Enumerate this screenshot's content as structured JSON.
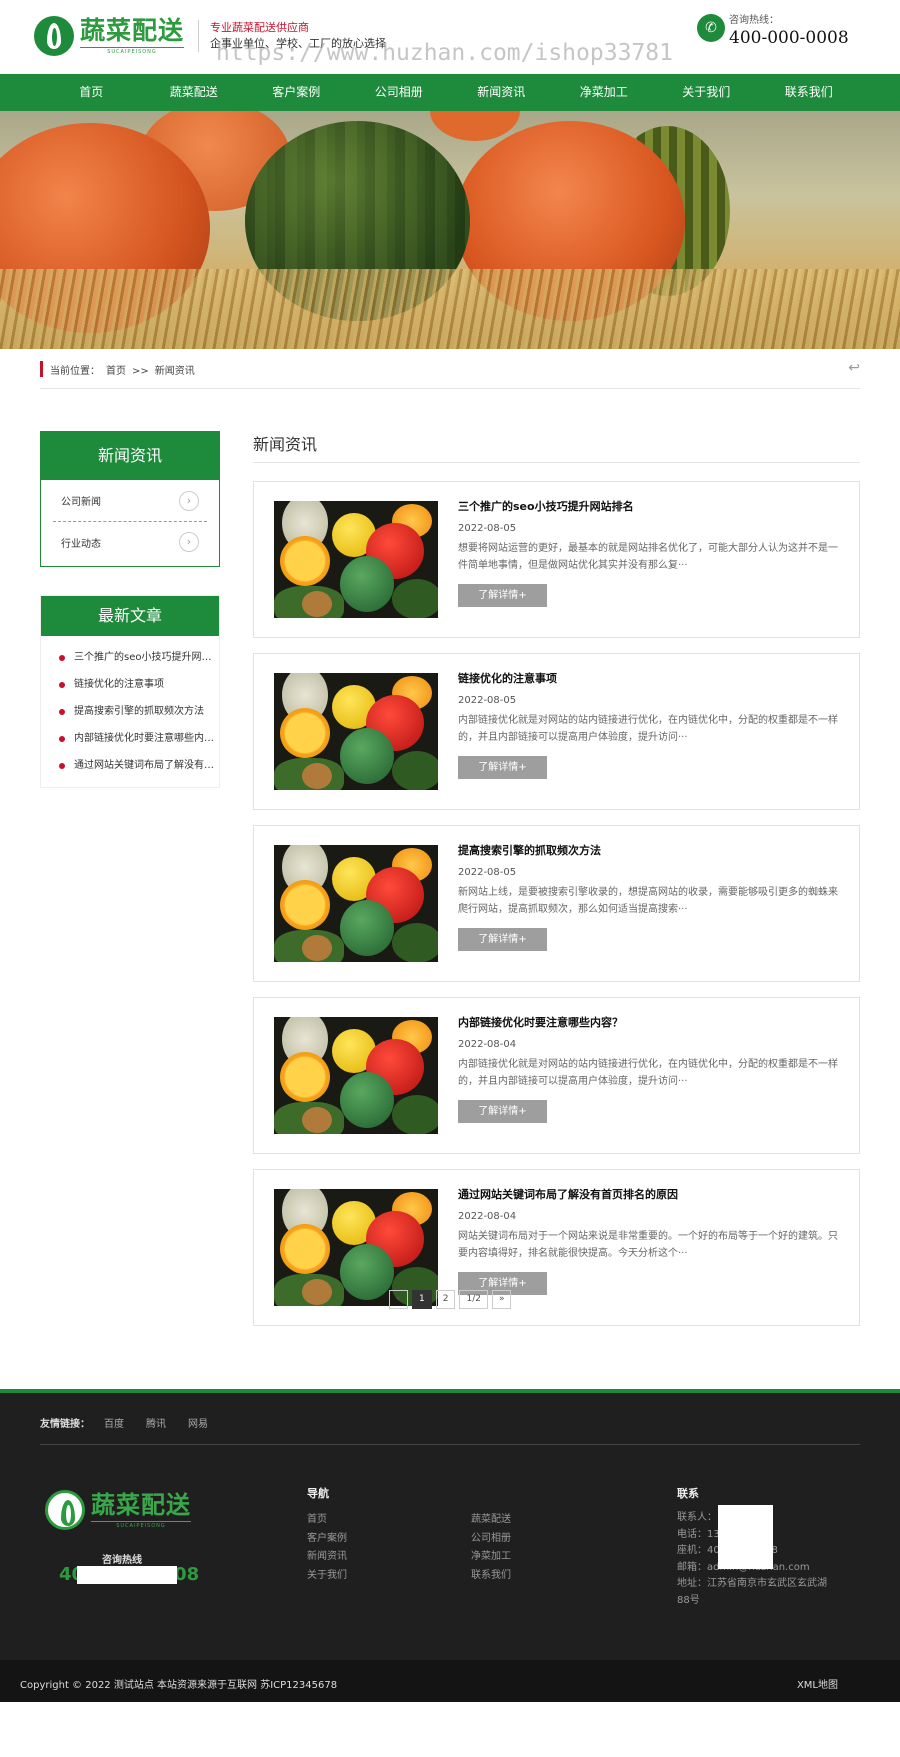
{
  "header": {
    "logo_cn": "蔬菜配送",
    "logo_en": "SUCAIPEISONG",
    "slogan_1": "专业蔬菜配送供应商",
    "slogan_2": "企事业单位、学校、工厂的放心选择",
    "watermark": "https://www.huzhan.com/ishop33781",
    "hotline_label": "咨询热线：",
    "hotline_number": "400-000-0008"
  },
  "nav": [
    "首页",
    "蔬菜配送",
    "客户案例",
    "公司相册",
    "新闻资讯",
    "净菜加工",
    "关于我们",
    "联系我们"
  ],
  "breadcrumb": {
    "label": "当前位置：",
    "home": "首页",
    "sep": ">>",
    "current": "新闻资讯"
  },
  "sidebar": {
    "category_title": "新闻资讯",
    "categories": [
      "公司新闻",
      "行业动态"
    ],
    "latest_title": "最新文章",
    "latest": [
      "三个推广的seo小技巧提升网站排名",
      "链接优化的注意事项",
      "提高搜索引擎的抓取频次方法",
      "内部链接优化时要注意哪些内容？",
      "通过网站关键词布局了解没有首页排名的原因"
    ]
  },
  "content": {
    "title": "新闻资讯",
    "more_label": "了解详情+",
    "news": [
      {
        "title": "三个推广的seo小技巧提升网站排名",
        "date": "2022-08-05",
        "desc": "想要将网站运营的更好，最基本的就是网站排名优化了，可能大部分人认为这并不是一件简单地事情，但是做网站优化其实并没有那么复···"
      },
      {
        "title": "链接优化的注意事项",
        "date": "2022-08-05",
        "desc": "内部链接优化就是对网站的站内链接进行优化，在内链优化中，分配的权重都是不一样的，并且内部链接可以提高用户体验度，提升访问···"
      },
      {
        "title": "提高搜索引擎的抓取频次方法",
        "date": "2022-08-05",
        "desc": "新网站上线，是要被搜索引擎收录的，想提高网站的收录，需要能够吸引更多的蜘蛛来爬行网站，提高抓取频次，那么如何适当提高搜索···"
      },
      {
        "title": "内部链接优化时要注意哪些内容？",
        "date": "2022-08-04",
        "desc": "内部链接优化就是对网站的站内链接进行优化，在内链优化中，分配的权重都是不一样的，并且内部链接可以提高用户体验度，提升访问···"
      },
      {
        "title": "通过网站关键词布局了解没有首页排名的原因",
        "date": "2022-08-04",
        "desc": "网站关键词布局对于一个网站来说是非常重要的。一个好的布局等于一个好的建筑。只要内容填得好，排名就能很快提高。今天分析这个···"
      }
    ],
    "pager": {
      "prev": "«",
      "pages": [
        "1",
        "2"
      ],
      "active": "1",
      "total": "1/2",
      "next": "»"
    }
  },
  "footer": {
    "links_label": "友情链接：",
    "links": [
      "百度",
      "腾讯",
      "网易"
    ],
    "hotline_label": "咨询热线",
    "hotline_number": "400-000-0008",
    "nav_title": "导航",
    "nav": [
      "首页",
      "蔬菜配送",
      "客户案例",
      "公司相册",
      "新闻资讯",
      "净菜加工",
      "关于我们",
      "联系我们"
    ],
    "contact_title": "联系",
    "contact": [
      "联系人：",
      "电话：13",
      "座机：400-000-0008",
      "邮箱：admin@huzhan.com",
      "地址：江苏省南京市玄武区玄武湖88号"
    ],
    "copyright": "Copyright © 2022 测试站点 本站资源来源于互联网    苏ICP12345678",
    "sitemap": "XML地图"
  },
  "colors": {
    "brand_green": "#1d8a3c",
    "accent_red": "#c8102e",
    "footer_bg": "#1f1f1f"
  }
}
